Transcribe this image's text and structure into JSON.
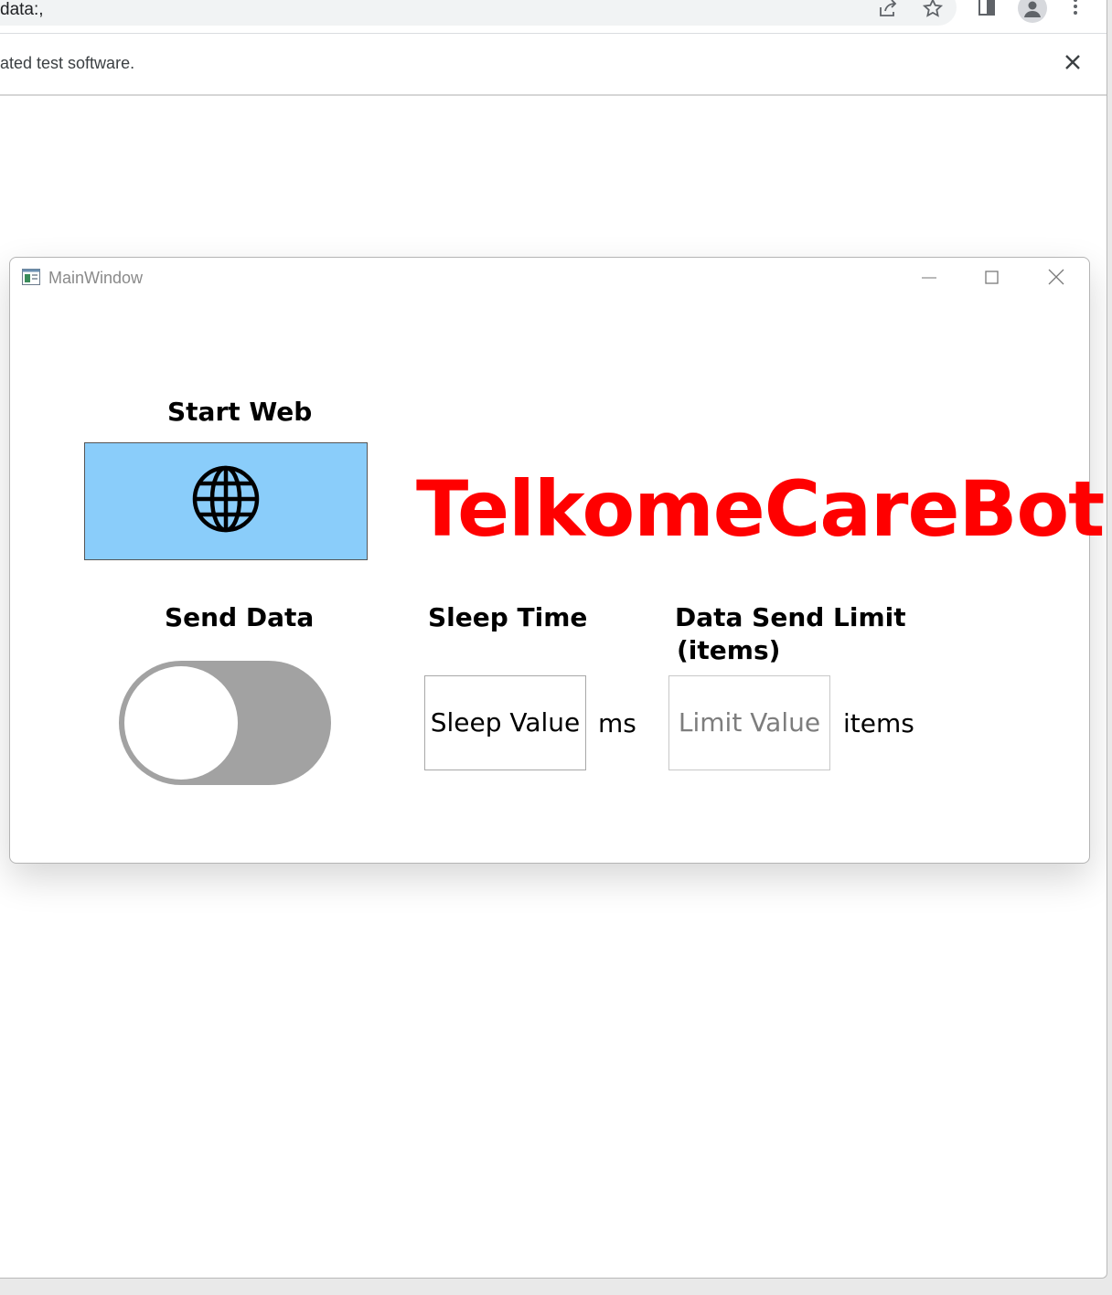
{
  "browser": {
    "url": "data:,",
    "infobar_text": "ated test software."
  },
  "window": {
    "title": "MainWindow"
  },
  "labels": {
    "start_web": "Start Web",
    "send_data": "Send Data",
    "sleep_time": "Sleep Time",
    "data_send_limit": "Data Send Limit",
    "data_send_limit_sub": "(items)"
  },
  "brand": "TelkomeCareBot",
  "sleep_input": {
    "value": "Sleep Value",
    "unit": "ms"
  },
  "limit_input": {
    "placeholder": "Limit Value",
    "unit": "items"
  },
  "toggle": {
    "on": false
  },
  "colors": {
    "brand": "#ff0000",
    "button_bg": "#8acdfa",
    "toggle_off": "#a2a2a2"
  }
}
